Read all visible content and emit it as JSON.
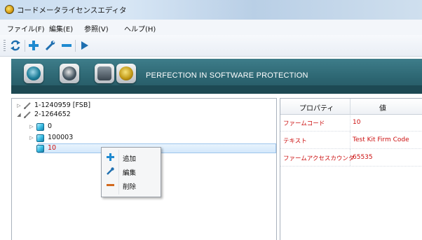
{
  "window": {
    "title": "コードメータライセンスエディタ"
  },
  "menu": {
    "items": [
      "ファイル(F)",
      "編集(E)",
      "参照(V)",
      "ヘルプ(H)"
    ]
  },
  "toolbar": {
    "buttons": [
      "refresh-icon",
      "add-icon",
      "edit-icon",
      "remove-icon",
      "play-icon"
    ]
  },
  "banner": {
    "icons": [
      "codemeter-icon",
      "browser-icon",
      "license-icon",
      "gear-icon"
    ],
    "tagline": "PERFECTION IN SOFTWARE PROTECTION"
  },
  "tree": {
    "nodes": [
      {
        "label": "1-1240959 [FSB]",
        "expanded": false
      },
      {
        "label": "2-1264652",
        "expanded": true
      },
      {
        "label": "0",
        "expanded": false
      },
      {
        "label": "100003",
        "expanded": false
      },
      {
        "label": "10",
        "selected": true
      }
    ]
  },
  "context_menu": {
    "items": [
      {
        "label": "追加",
        "icon": "add-icon"
      },
      {
        "label": "編集",
        "icon": "edit-icon"
      },
      {
        "label": "削除",
        "icon": "remove-icon"
      }
    ]
  },
  "properties": {
    "headers": {
      "property": "プロパティ",
      "value": "値"
    },
    "rows": [
      {
        "key": "ファームコード",
        "value": "10"
      },
      {
        "key": "テキスト",
        "value": "Test Kit Firm Code"
      },
      {
        "key": "ファームアクセスカウンタ",
        "value": "65535"
      }
    ]
  },
  "colors": {
    "banner": "#2d6672",
    "highlight_text": "#cc1010",
    "selection": "#d3e8fb"
  }
}
